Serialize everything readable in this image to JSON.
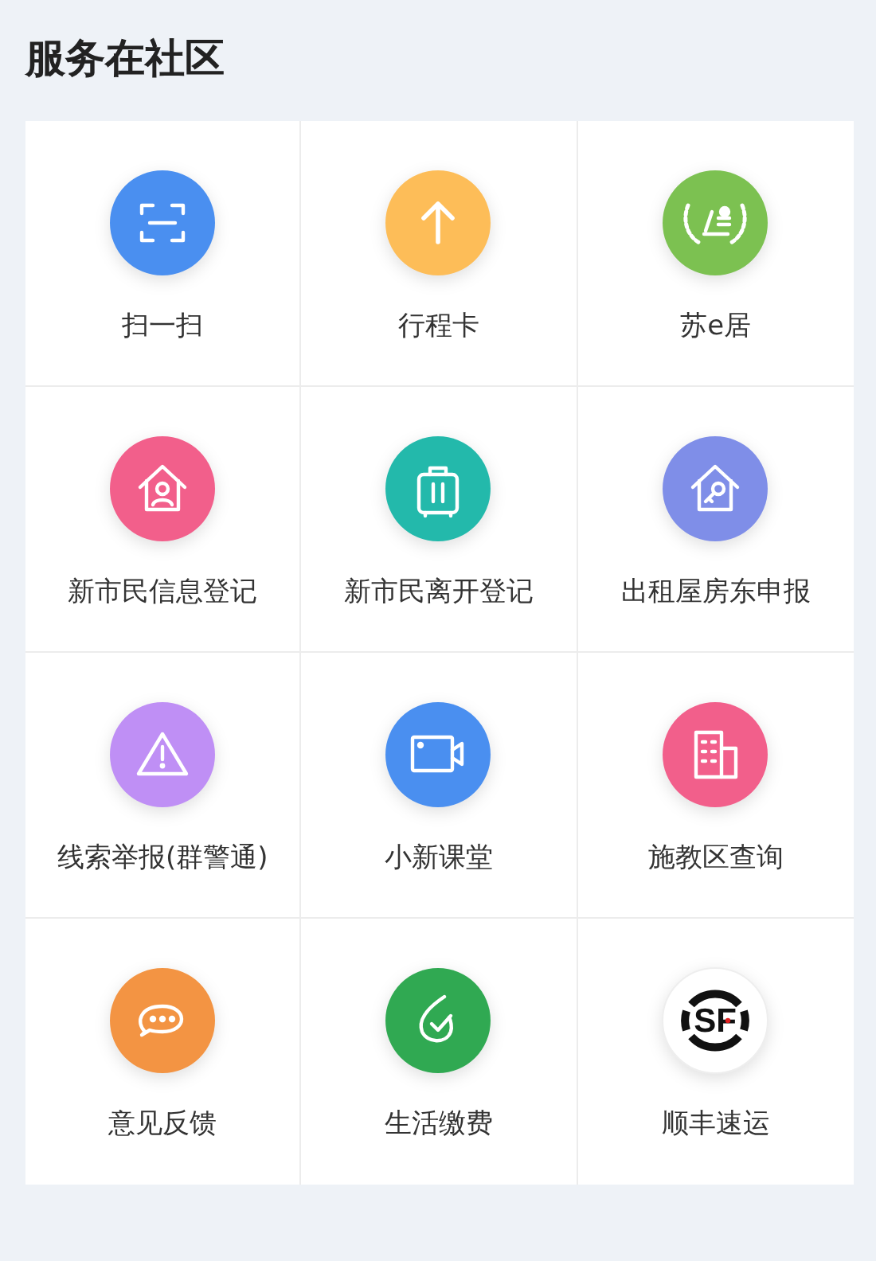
{
  "title": "服务在社区",
  "services": [
    {
      "label": "扫一扫",
      "kind": "scan",
      "color": "#4a8ff0"
    },
    {
      "label": "行程卡",
      "kind": "arrow",
      "color": "#fdbd58"
    },
    {
      "label": "苏e居",
      "kind": "laurel",
      "color": "#7cc151"
    },
    {
      "label": "新市民信息登记",
      "kind": "house-person",
      "color": "#f25f8b"
    },
    {
      "label": "新市民离开登记",
      "kind": "suitcase",
      "color": "#23b9ab"
    },
    {
      "label": "出租屋房东申报",
      "kind": "house-key",
      "color": "#7f8ee8"
    },
    {
      "label": "线索举报(群警通)",
      "kind": "warning",
      "color": "#bf8ff5"
    },
    {
      "label": "小新课堂",
      "kind": "video",
      "color": "#4a8ff0"
    },
    {
      "label": "施教区查询",
      "kind": "building",
      "color": "#f25f8b"
    },
    {
      "label": "意见反馈",
      "kind": "chat",
      "color": "#f39443"
    },
    {
      "label": "生活缴费",
      "kind": "drop-check",
      "color": "#30a952"
    },
    {
      "label": "顺丰速运",
      "kind": "logo",
      "color": "#ffffff"
    }
  ],
  "courier_logo_text": "SF"
}
